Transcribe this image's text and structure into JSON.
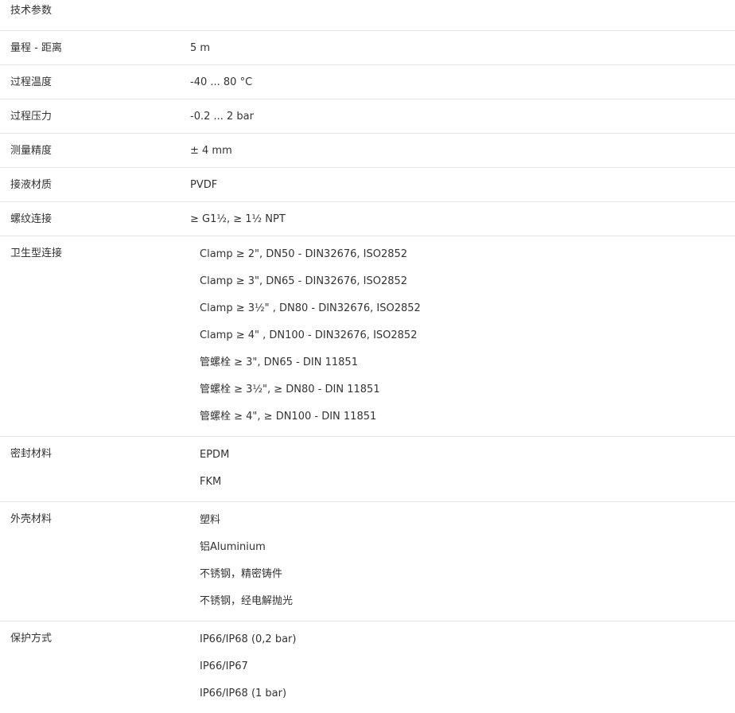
{
  "header": {
    "title": "技术参数"
  },
  "single_rows": [
    {
      "label": "量程 - 距离",
      "value": "5 m"
    },
    {
      "label": "过程温度",
      "value": "-40 ... 80 °C"
    },
    {
      "label": "过程压力",
      "value": "-0.2 ... 2 bar"
    },
    {
      "label": "测量精度",
      "value": "± 4 mm"
    },
    {
      "label": "接液材质",
      "value": "PVDF"
    },
    {
      "label": "螺纹连接",
      "value": "≥ G1½, ≥ 1½ NPT"
    }
  ],
  "multi_rows": [
    {
      "label": "卫生型连接",
      "values": [
        "Clamp ≥ 2\", DN50 - DIN32676, ISO2852",
        "Clamp ≥ 3\", DN65 - DIN32676, ISO2852",
        "Clamp ≥ 3½\" , DN80 - DIN32676, ISO2852",
        "Clamp ≥ 4\" , DN100 - DIN32676, ISO2852",
        "管螺栓 ≥ 3\", DN65 - DIN 11851",
        "管螺栓 ≥ 3½\", ≥ DN80 - DIN 11851",
        "管螺栓 ≥ 4\", ≥ DN100 - DIN 11851"
      ]
    },
    {
      "label": "密封材料",
      "values": [
        "EPDM",
        "FKM"
      ]
    },
    {
      "label": "外壳材料",
      "values": [
        "塑料",
        "铝Aluminium",
        "不锈钢，精密铸件",
        "不锈钢，经电解抛光"
      ]
    },
    {
      "label": "保护方式",
      "values": [
        "IP66/IP68 (0,2 bar)",
        "IP66/IP67",
        "IP66/IP68 (1 bar)"
      ]
    }
  ]
}
